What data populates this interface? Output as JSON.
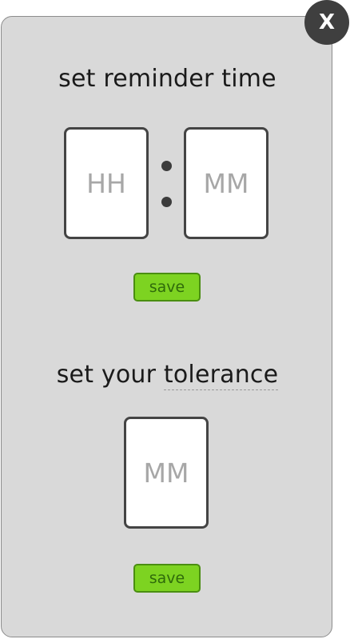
{
  "dialog": {
    "close_label": "X"
  },
  "reminder": {
    "title": "set reminder time",
    "hours_placeholder": "HH",
    "minutes_placeholder": "MM",
    "save_label": "save"
  },
  "tolerance": {
    "title_prefix": "set your ",
    "title_term": "tolerance",
    "minutes_placeholder": "MM",
    "save_label": "save"
  },
  "colors": {
    "panel_bg": "#d9d9d9",
    "save_button": "#7dd321",
    "close_button": "#3f3f3f"
  }
}
